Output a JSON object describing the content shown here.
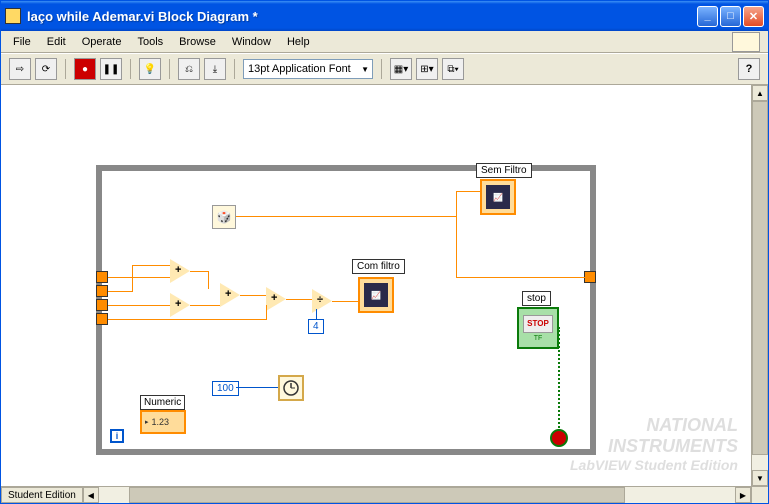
{
  "window": {
    "title": "laço while Ademar.vi Block Diagram *"
  },
  "menu": {
    "file": "File",
    "edit": "Edit",
    "operate": "Operate",
    "tools": "Tools",
    "browse": "Browse",
    "window": "Window",
    "help": "Help"
  },
  "toolbar": {
    "font": "13pt Application Font",
    "help": "?"
  },
  "nodes": {
    "sem_filtro": "Sem Filtro",
    "com_filtro": "Com filtro",
    "stop": "stop",
    "stop_btn": "STOP",
    "stop_tf": "TF",
    "const4": "4",
    "const100": "100",
    "numeric": "Numeric",
    "numeric_val": "1.23",
    "iter": "i"
  },
  "status": {
    "edition": "Student Edition"
  },
  "watermark": {
    "line1": "NATIONAL",
    "line2": "INSTRUMENTS",
    "line3": "LabVIEW Student Edition"
  }
}
